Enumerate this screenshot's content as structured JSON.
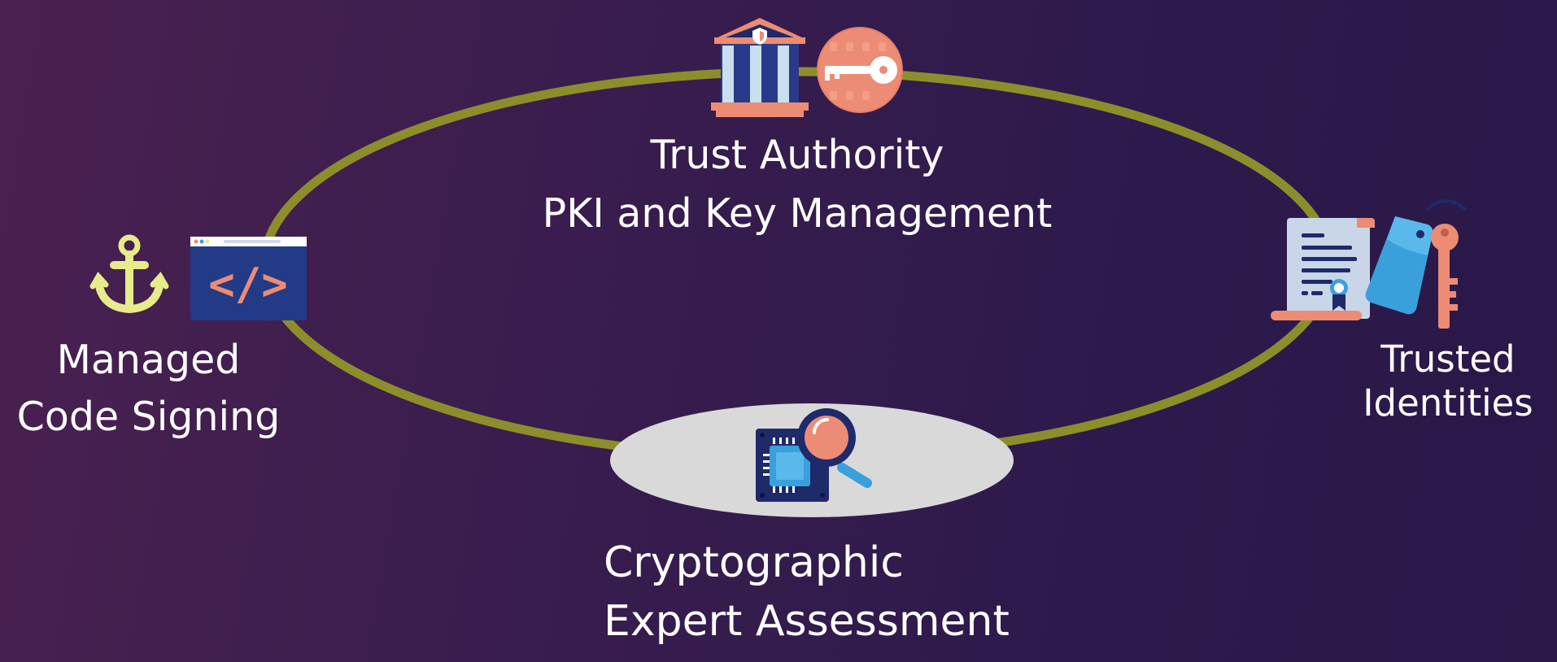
{
  "colors": {
    "ring": "#8c8e2b",
    "center_ellipse": "#d9d9d9",
    "text": "#ffffff",
    "accent_coral": "#ec8c74",
    "accent_navy": "#1e2a6a",
    "accent_blue": "#3aa0dc",
    "anchor_yellow": "#e7eb8a"
  },
  "nodes": {
    "top": {
      "line1": "Trust Authority",
      "line2": "PKI and Key Management",
      "icons": [
        "bank-icon",
        "key-lock-icon"
      ]
    },
    "left": {
      "line1": "Managed",
      "line2": "Code Signing",
      "icons": [
        "anchor-icon",
        "code-window-icon"
      ]
    },
    "right": {
      "line1": "Trusted",
      "line2": "Identities",
      "icons": [
        "certificate-icon",
        "key-tag-icon"
      ]
    },
    "bottom": {
      "line1": "Cryptographic",
      "line2": "Expert Assessment",
      "icons": [
        "chip-magnifier-icon"
      ]
    }
  }
}
